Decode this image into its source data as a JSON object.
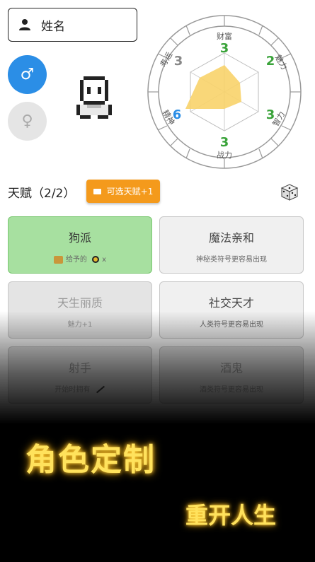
{
  "name_field": {
    "placeholder": "姓名",
    "icon": "person-icon"
  },
  "gender": {
    "male_symbol": "♂",
    "female_symbol": "♀",
    "selected": "male"
  },
  "attributes": [
    {
      "label": "财富",
      "value": "3",
      "color": "#3aa33a"
    },
    {
      "label": "魅力",
      "value": "2",
      "color": "#3aa33a"
    },
    {
      "label": "智力",
      "value": "3",
      "color": "#3aa33a"
    },
    {
      "label": "战力",
      "value": "3",
      "color": "#3aa33a"
    },
    {
      "label": "精神",
      "value": "6",
      "color": "#2b8ee6"
    },
    {
      "label": "寿运",
      "value": "3",
      "color": "#888888"
    }
  ],
  "talents": {
    "title": "天赋（2/2）",
    "extra_button": "可选天赋+1",
    "dice_icon": "dice-icon",
    "cards": [
      {
        "title": "狗派",
        "desc": "给予的",
        "state": "selected"
      },
      {
        "title": "魔法亲和",
        "desc": "神秘类符号更容易出现",
        "state": "normal"
      },
      {
        "title": "天生丽质",
        "desc": "魅力+1",
        "state": "disabled"
      },
      {
        "title": "社交天才",
        "desc": "人类符号更容易出现",
        "state": "normal"
      },
      {
        "title": "射手",
        "desc": "开始时拥有",
        "state": "disabled"
      },
      {
        "title": "酒鬼",
        "desc": "酒类符号更容易出现",
        "state": "disabled"
      }
    ],
    "card1_suffix": "x"
  },
  "promo": {
    "headline": "角色定制",
    "subline": "重开人生"
  },
  "colors": {
    "selected_card": "#a7e0a0",
    "accent_orange": "#f49a1c",
    "male_blue": "#2b8ee6",
    "promo_yellow": "#ffe25c"
  }
}
